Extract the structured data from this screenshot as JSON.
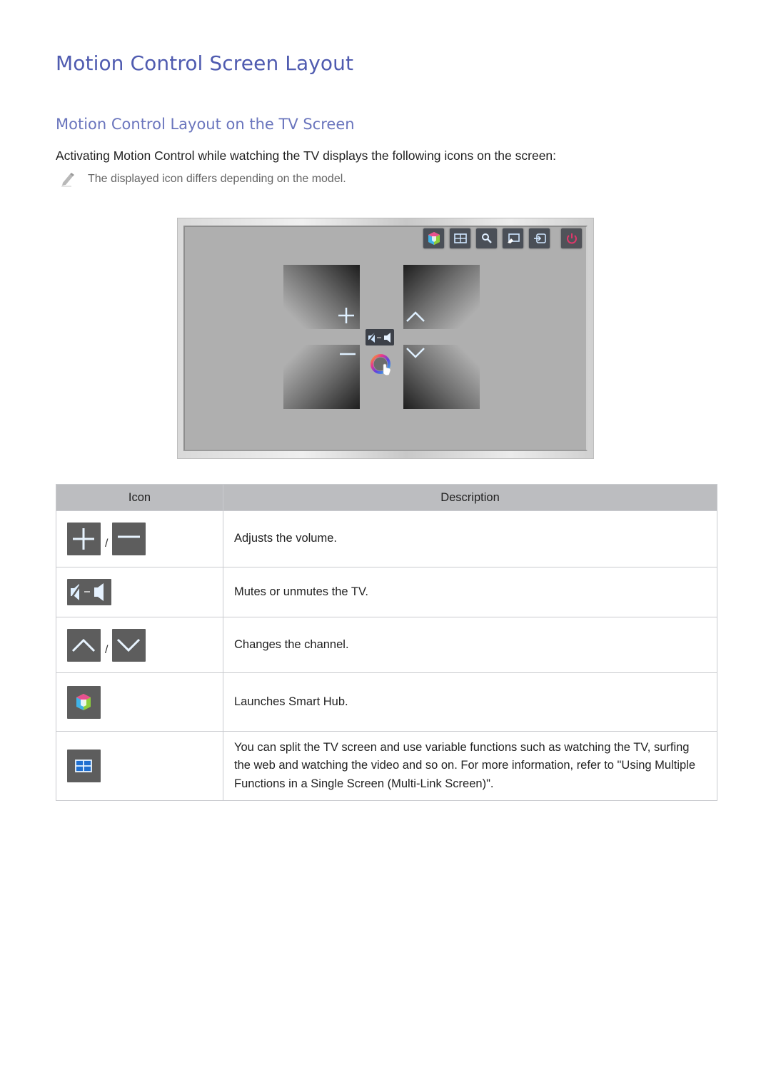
{
  "page": {
    "title": "Motion Control Screen Layout",
    "subtitle": "Motion Control Layout on the TV Screen",
    "intro": "Activating Motion Control while watching the TV displays the following icons on the screen:",
    "note": {
      "icon": "pencil-note-icon",
      "text": "The displayed icon differs depending on the model."
    }
  },
  "tv_illustration": {
    "top_bar_icons": [
      "smart-hub-icon",
      "multi-link-screen-icon",
      "search-icon",
      "screen-share-icon",
      "source-input-icon",
      "power-icon"
    ],
    "center_icons": [
      "volume-up-icon",
      "volume-down-icon",
      "channel-up-icon",
      "channel-down-icon",
      "mute-toggle-icon",
      "hand-cursor-icon"
    ],
    "colors": {
      "glow": "#3aa0ff",
      "power": "#e0386b",
      "panel_bg": "#afafaf"
    }
  },
  "table": {
    "headers": {
      "icon": "Icon",
      "description": "Description"
    },
    "separator": "/",
    "rows": [
      {
        "icons": [
          "volume-up-icon",
          "volume-down-icon"
        ],
        "description": "Adjusts the volume."
      },
      {
        "icons": [
          "mute-toggle-icon"
        ],
        "description": "Mutes or unmutes the TV."
      },
      {
        "icons": [
          "channel-up-icon",
          "channel-down-icon"
        ],
        "description": "Changes the channel."
      },
      {
        "icons": [
          "smart-hub-icon"
        ],
        "description": "Launches Smart Hub."
      },
      {
        "icons": [
          "multi-link-screen-icon"
        ],
        "description": "You can split the TV screen and use variable functions such as watching the TV, surfing the web and watching the video and so on. For more information, refer to \"Using Multiple Functions in a Single Screen (Multi-Link Screen)\"."
      }
    ]
  }
}
